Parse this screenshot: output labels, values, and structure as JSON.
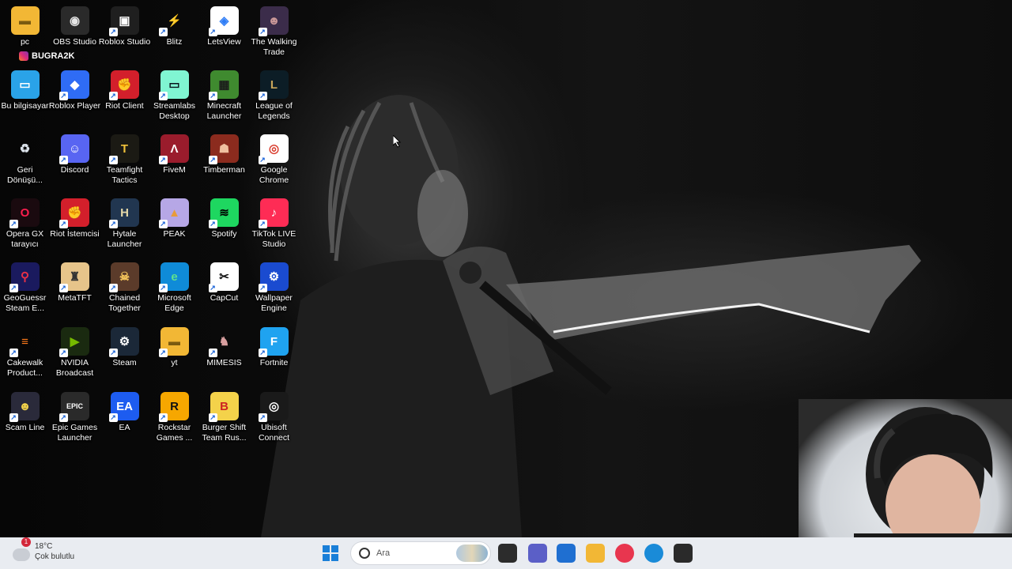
{
  "watermark": "BUGRA2K",
  "icons": [
    {
      "label": "pc",
      "glyph": "▬",
      "bg": "#f2b735",
      "fg": "#7a5a10"
    },
    {
      "label": "OBS Studio",
      "glyph": "◉",
      "bg": "#2a2a2a",
      "fg": "#e6e6e6"
    },
    {
      "label": "Roblox Studio",
      "glyph": "▣",
      "bg": "#1f1f1f",
      "fg": "#fff"
    },
    {
      "label": "Blitz",
      "glyph": "⚡",
      "bg": "transparent",
      "fg": "#e83146"
    },
    {
      "label": "LetsView",
      "glyph": "◈",
      "bg": "#ffffff",
      "fg": "#2d7cf6"
    },
    {
      "label": "The Walking Trade",
      "glyph": "☻",
      "bg": "#3b2c4a",
      "fg": "#c99"
    },
    {
      "label": "Bu bilgisayar",
      "glyph": "▭",
      "bg": "#2aa3e8",
      "fg": "#fff"
    },
    {
      "label": "Roblox Player",
      "glyph": "◆",
      "bg": "#2f6cf5",
      "fg": "#fff"
    },
    {
      "label": "Riot Client",
      "glyph": "✊",
      "bg": "#d31f2b",
      "fg": "#fff"
    },
    {
      "label": "Streamlabs Desktop",
      "glyph": "▭",
      "bg": "#80f5d2",
      "fg": "#09161d"
    },
    {
      "label": "Minecraft Launcher",
      "glyph": "▦",
      "bg": "#3f8a2f",
      "fg": "#1b1b1b"
    },
    {
      "label": "League of Legends",
      "glyph": "L",
      "bg": "#0c1d26",
      "fg": "#c8a55a"
    },
    {
      "label": "Geri Dönüşü...",
      "glyph": "♻",
      "bg": "transparent",
      "fg": "#dfe6ee"
    },
    {
      "label": "Discord",
      "glyph": "☺",
      "bg": "#5865f2",
      "fg": "#fff"
    },
    {
      "label": "Teamfight Tactics",
      "glyph": "T",
      "bg": "#1b1a14",
      "fg": "#f0c23a"
    },
    {
      "label": "FiveM",
      "glyph": "Λ",
      "bg": "#9a1c2c",
      "fg": "#fff"
    },
    {
      "label": "Timberman",
      "glyph": "☗",
      "bg": "#8b2b1e",
      "fg": "#f0c0a0"
    },
    {
      "label": "Google Chrome",
      "glyph": "◎",
      "bg": "#ffffff",
      "fg": "#d93a2b"
    },
    {
      "label": "Opera GX tarayıcı",
      "glyph": "O",
      "bg": "#1a0a0f",
      "fg": "#fa1e4e"
    },
    {
      "label": "Riot İstemcisi",
      "glyph": "✊",
      "bg": "#d31f2b",
      "fg": "#fff"
    },
    {
      "label": "Hytale Launcher",
      "glyph": "H",
      "bg": "#213650",
      "fg": "#e6d9a8"
    },
    {
      "label": "PEAK",
      "glyph": "▲",
      "bg": "#b6a7e6",
      "fg": "#e89b3a"
    },
    {
      "label": "Spotify",
      "glyph": "≋",
      "bg": "#1ed760",
      "fg": "#000"
    },
    {
      "label": "TikTok LIVE Studio",
      "glyph": "♪",
      "bg": "#fe2c55",
      "fg": "#fff"
    },
    {
      "label": "GeoGuessr Steam E...",
      "glyph": "⚲",
      "bg": "#1a1a5e",
      "fg": "#e83146"
    },
    {
      "label": "MetaTFT",
      "glyph": "♜",
      "bg": "#e6c48a",
      "fg": "#333"
    },
    {
      "label": "Chained Together",
      "glyph": "☠",
      "bg": "#5b3b2a",
      "fg": "#f2c25a"
    },
    {
      "label": "Microsoft Edge",
      "glyph": "e",
      "bg": "#0f8bd8",
      "fg": "#5ee28e"
    },
    {
      "label": "CapCut",
      "glyph": "✂",
      "bg": "#ffffff",
      "fg": "#111"
    },
    {
      "label": "Wallpaper Engine",
      "glyph": "⚙",
      "bg": "#1a4bd0",
      "fg": "#fff"
    },
    {
      "label": "Cakewalk Product...",
      "glyph": "≡",
      "bg": "transparent",
      "fg": "#ff7a1a"
    },
    {
      "label": "NVIDIA Broadcast",
      "glyph": "▶",
      "bg": "#1a2a10",
      "fg": "#76b900"
    },
    {
      "label": "Steam",
      "glyph": "⚙",
      "bg": "#1b2838",
      "fg": "#fff"
    },
    {
      "label": "yt",
      "glyph": "▬",
      "bg": "#f2b735",
      "fg": "#7a5a10"
    },
    {
      "label": "MIMESIS",
      "glyph": "♞",
      "bg": "transparent",
      "fg": "#d9a0a0"
    },
    {
      "label": "Fortnite",
      "glyph": "F",
      "bg": "#1fa3f0",
      "fg": "#fff"
    },
    {
      "label": "Scam Line",
      "glyph": "☻",
      "bg": "#2a2a3a",
      "fg": "#f2d24a"
    },
    {
      "label": "Epic Games Launcher",
      "glyph": "EPIC",
      "bg": "#2a2a2a",
      "fg": "#fff"
    },
    {
      "label": "EA",
      "glyph": "EA",
      "bg": "#1d5cf0",
      "fg": "#fff"
    },
    {
      "label": "Rockstar Games ...",
      "glyph": "R",
      "bg": "#f6a700",
      "fg": "#111"
    },
    {
      "label": "Burger Shift Team Rus...",
      "glyph": "B",
      "bg": "#f4d24a",
      "fg": "#c22"
    },
    {
      "label": "Ubisoft Connect",
      "glyph": "◎",
      "bg": "#1a1a1a",
      "fg": "#fff"
    }
  ],
  "taskbar": {
    "weather_temp": "18°C",
    "weather_desc": "Çok bulutlu",
    "weather_badge": "1",
    "search_placeholder": "Ara",
    "apps": [
      {
        "name": "task-view",
        "color": "#2c2c2c"
      },
      {
        "name": "teams",
        "color": "#5b5fc7"
      },
      {
        "name": "microsoft-store",
        "color": "#1f6fd1"
      },
      {
        "name": "file-explorer",
        "color": "#f2b735"
      },
      {
        "name": "opera-gx",
        "color": "#e8364f"
      },
      {
        "name": "edge",
        "color": "#1a8bd8"
      },
      {
        "name": "app-red-badge",
        "color": "#2a2a2a"
      }
    ]
  }
}
